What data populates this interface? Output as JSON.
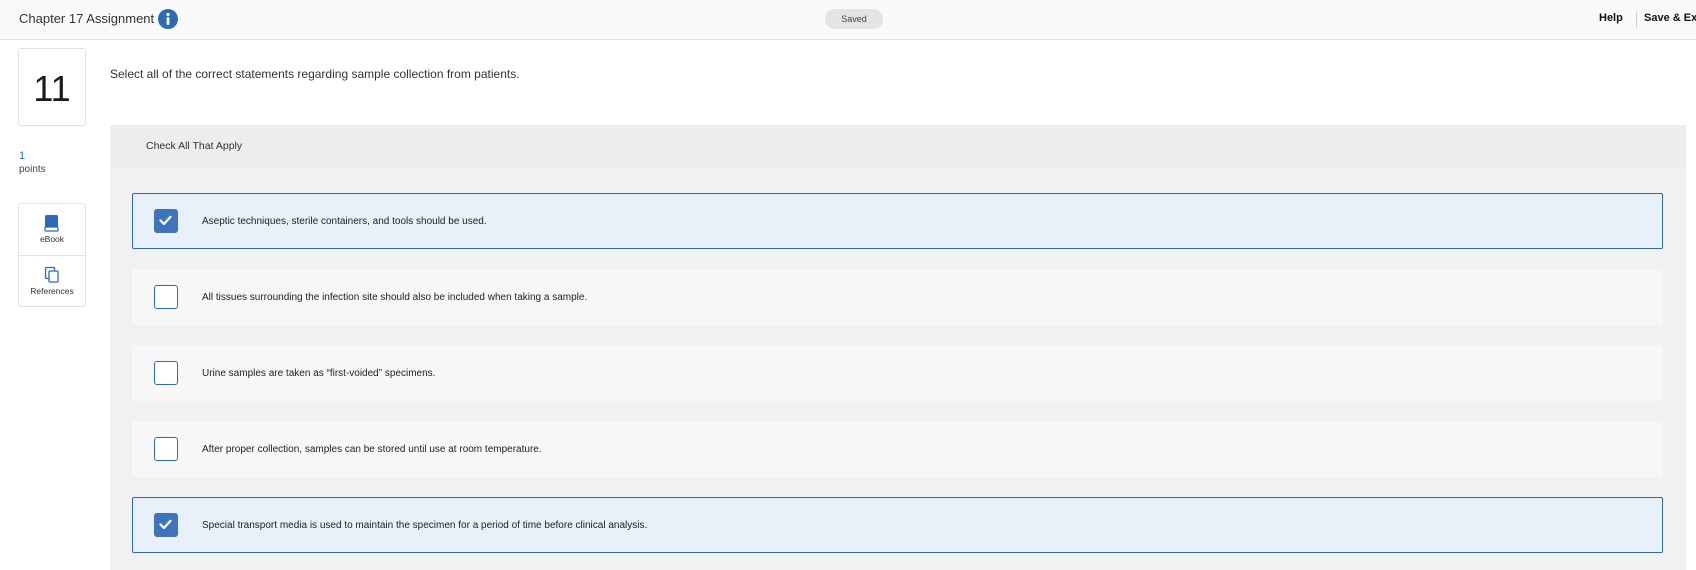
{
  "header": {
    "title": "Chapter 17 Assignment",
    "status": "Saved",
    "help_label": "Help",
    "save_exit_label": "Save & Ex"
  },
  "question": {
    "number": "11",
    "points_value": "1",
    "points_label": "points",
    "prompt": "Select all of the correct statements regarding sample collection from patients.",
    "instruction": "Check All That Apply"
  },
  "tools": {
    "ebook_label": "eBook",
    "references_label": "References"
  },
  "options": [
    {
      "text": "Aseptic techniques, sterile containers, and tools should be used.",
      "checked": true
    },
    {
      "text": "All tissues surrounding the infection site should also be included when taking a sample.",
      "checked": false
    },
    {
      "text": "Urine samples are taken as “first-voided” specimens.",
      "checked": false
    },
    {
      "text": "After proper collection, samples can be stored until use at room temperature.",
      "checked": false
    },
    {
      "text": "Special transport media is used to maintain the specimen for a period of time before clinical analysis.",
      "checked": true
    }
  ],
  "colors": {
    "accent": "#2f6ab4",
    "checked_bg": "#e8f0fa",
    "panel_bg": "#f1f1f1"
  }
}
